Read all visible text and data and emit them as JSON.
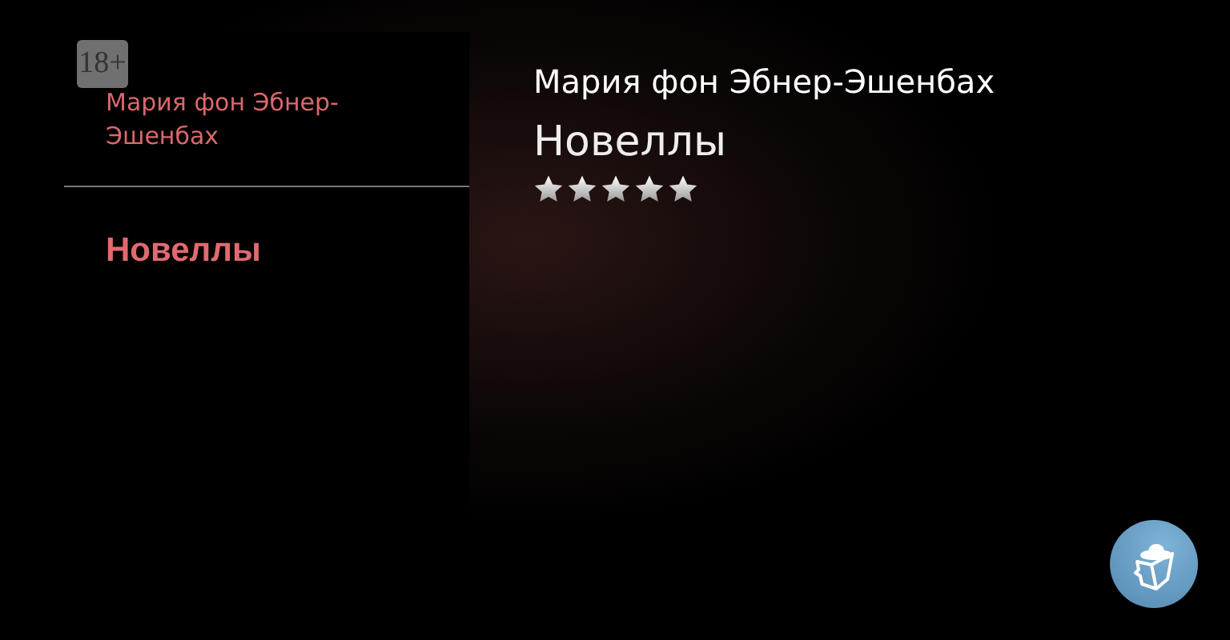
{
  "cover": {
    "age_badge": "18+",
    "author": "Мария фон Эбнер-Эшенбах",
    "title": "Новеллы"
  },
  "book": {
    "author": "Мария фон Эбнер-Эшенбах",
    "title": "Новеллы",
    "stars": 5
  }
}
